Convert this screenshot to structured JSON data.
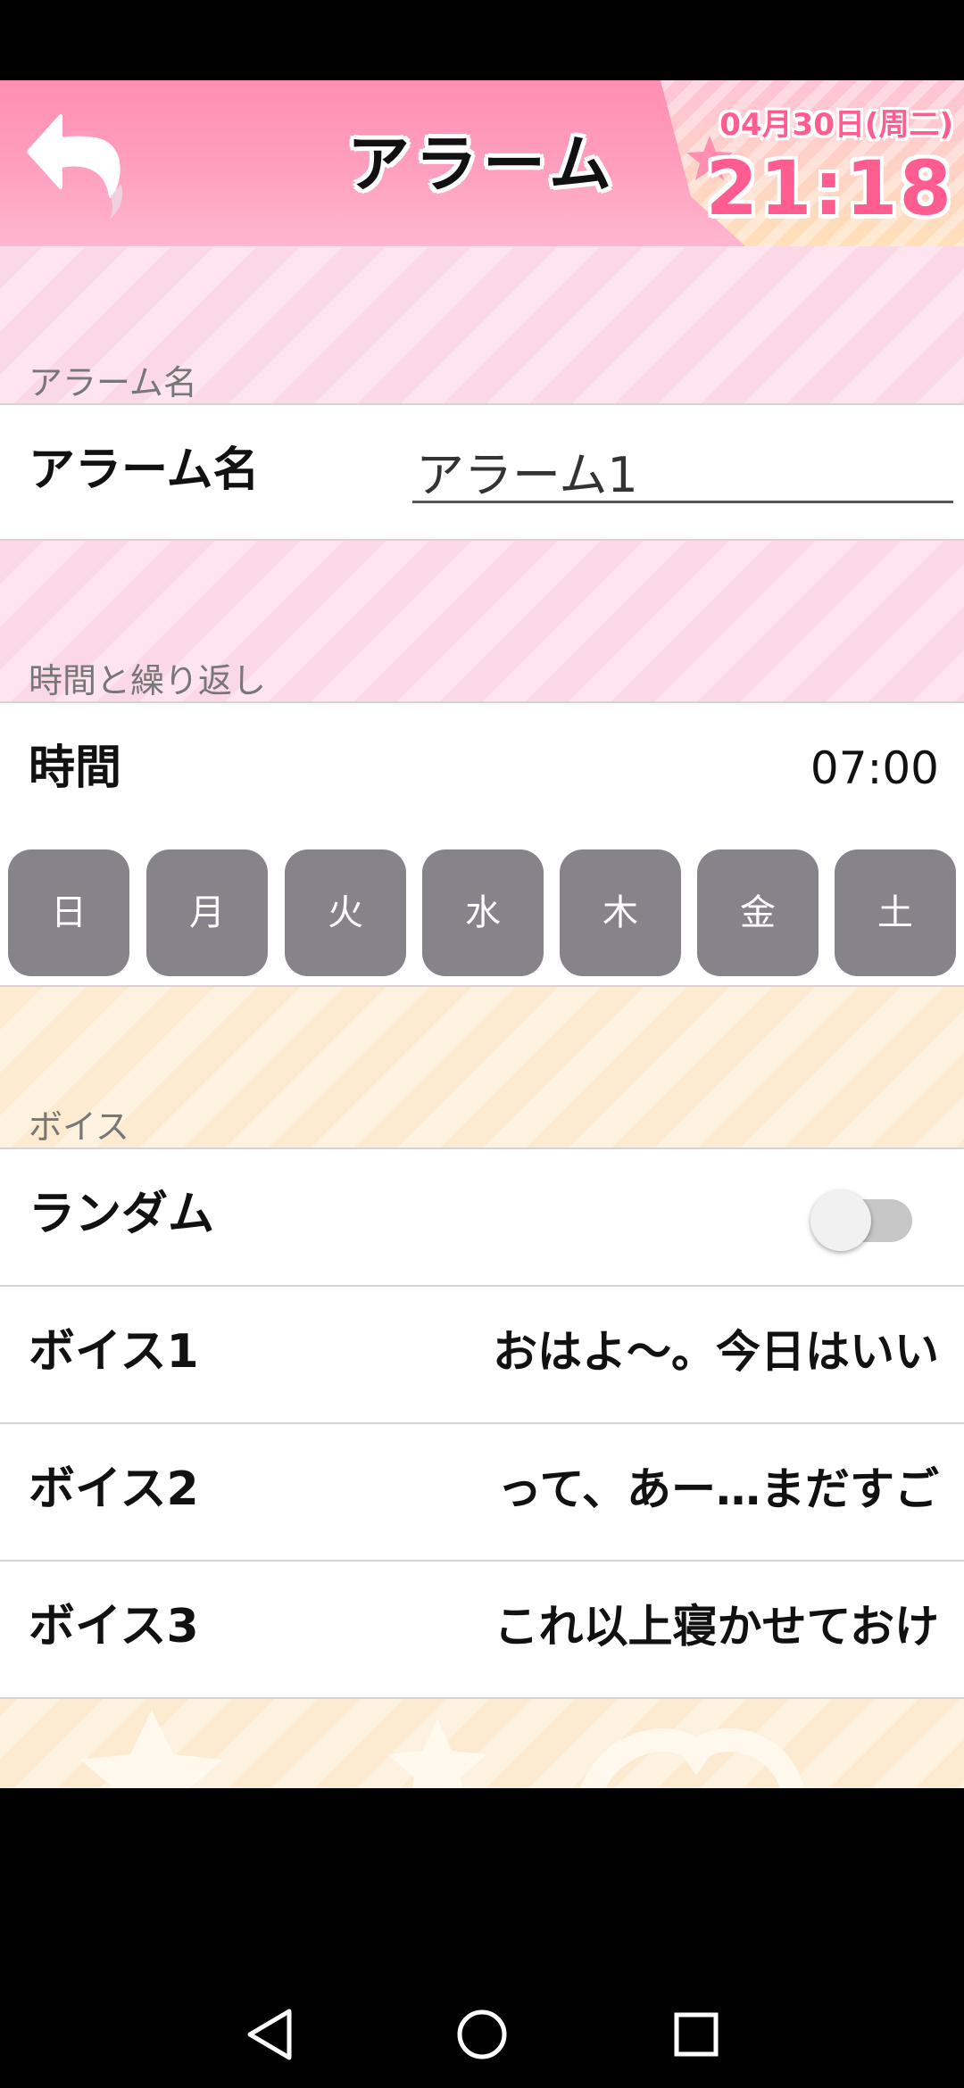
{
  "header": {
    "title": "アラーム",
    "date": "04月30日(周二)",
    "time": "21:18"
  },
  "sections": {
    "alarm_name_label": "アラーム名",
    "time_repeat_label": "時間と繰り返し",
    "voice_label": "ボイス"
  },
  "alarm_name": {
    "label": "アラーム名",
    "value": "アラーム1"
  },
  "time_row": {
    "label": "時間",
    "value": "07:00"
  },
  "days": [
    "日",
    "月",
    "火",
    "水",
    "木",
    "金",
    "土"
  ],
  "random_row": {
    "label": "ランダム",
    "enabled": false
  },
  "voices": [
    {
      "label": "ボイス1",
      "value": "おはよ〜。今日はいい"
    },
    {
      "label": "ボイス2",
      "value": "って、あー…まだすご"
    },
    {
      "label": "ボイス3",
      "value": "これ以上寝かせておけ"
    }
  ],
  "colors": {
    "header_pink": "#ff8fb1",
    "clock_pink": "#ff5d8f",
    "day_button": "#87838a"
  },
  "icons": {
    "back": "back-arrow-icon",
    "nav_back": "triangle-back-icon",
    "nav_home": "circle-home-icon",
    "nav_recents": "square-recents-icon"
  }
}
